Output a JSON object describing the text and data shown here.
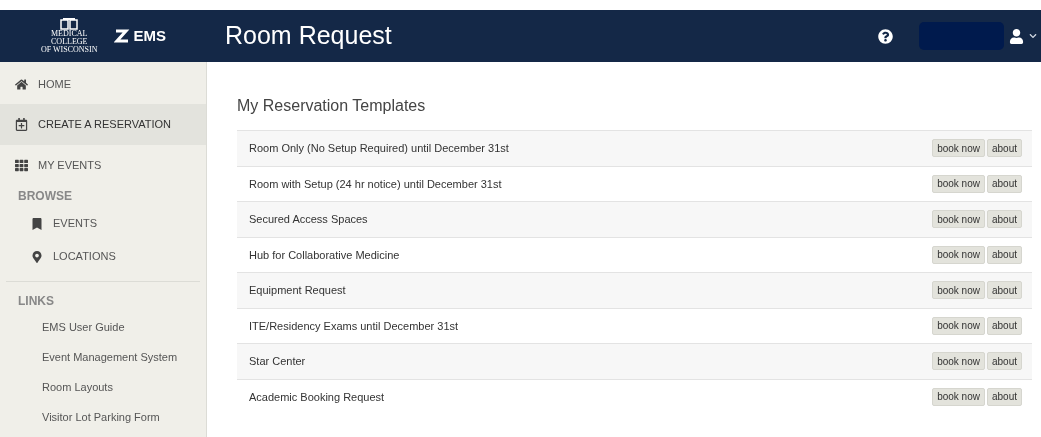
{
  "header": {
    "logo_lines": [
      "MEDICAL",
      "COLLEGE",
      "OF WISCONSIN"
    ],
    "brand": "EMS",
    "title": "Room Request"
  },
  "sidebar": {
    "items": [
      {
        "label": "HOME",
        "selected": false
      },
      {
        "label": "CREATE A RESERVATION",
        "selected": true
      },
      {
        "label": "MY EVENTS",
        "selected": false
      }
    ],
    "browse": {
      "heading": "BROWSE",
      "items": [
        "EVENTS",
        "LOCATIONS"
      ]
    },
    "links": {
      "heading": "LINKS",
      "items": [
        "EMS User Guide",
        "Event Management System",
        "Room Layouts",
        "Visitor Lot Parking Form"
      ]
    }
  },
  "main": {
    "heading": "My Reservation Templates",
    "templates": [
      {
        "name": "Room Only (No Setup Required) until December 31st",
        "buttons": [
          "book now",
          "about"
        ]
      },
      {
        "name": "Room with Setup (24 hr notice) until December 31st",
        "buttons": [
          "book now",
          "about"
        ]
      },
      {
        "name": "Secured Access Spaces",
        "buttons": [
          "book now",
          "about"
        ]
      },
      {
        "name": "Hub for Collaborative Medicine",
        "buttons": [
          "book now",
          "about"
        ]
      },
      {
        "name": "Equipment Request",
        "buttons": [
          "book now",
          "about"
        ]
      },
      {
        "name": "ITE/Residency Exams until December 31st",
        "buttons": [
          "book now",
          "about"
        ]
      },
      {
        "name": "Star Center",
        "buttons": [
          "book now",
          "about"
        ]
      },
      {
        "name": "Academic Booking Request",
        "buttons": [
          "book now",
          "about"
        ]
      }
    ]
  }
}
